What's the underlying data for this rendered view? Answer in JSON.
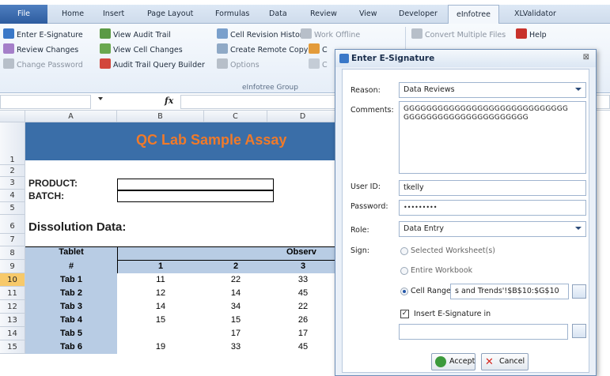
{
  "ribbon": {
    "tabs": [
      "File",
      "Home",
      "Insert",
      "Page Layout",
      "Formulas",
      "Data",
      "Review",
      "View",
      "Developer",
      "eInfotree",
      "XLValidator"
    ],
    "group_label": "eInfotree Group",
    "buttons": {
      "enter_esig": "Enter E-Signature",
      "review_changes": "Review Changes",
      "change_password": "Change Password",
      "view_audit_trail": "View Audit Trail",
      "view_cell_changes": "View Cell Changes",
      "audit_query_builder": "Audit Trail Query Builder",
      "cell_revision_history": "Cell Revision History",
      "create_remote_copy": "Create Remote Copy",
      "options": "Options",
      "work_offline": "Work Offline",
      "convert_multiple": "Convert Multiple Files",
      "help": "Help",
      "extra_c1": "C",
      "extra_c2": "C"
    }
  },
  "formula_bar": {
    "fx": "fx"
  },
  "sheet": {
    "columns": [
      "A",
      "B",
      "C",
      "D"
    ],
    "rows": [
      "1",
      "2",
      "3",
      "4",
      "5",
      "6",
      "7",
      "8",
      "9",
      "10",
      "11",
      "12",
      "13",
      "14",
      "15"
    ],
    "banner_title": "QC Lab Sample Assay",
    "product_label": "PRODUCT:",
    "batch_label": "BATCH:",
    "dissolution_label": "Dissolution Data:",
    "tablet_header": "Tablet",
    "hash_header": "#",
    "observ_header": "Observ",
    "obs_cols": [
      "1",
      "2",
      "3"
    ],
    "data_rows": [
      {
        "tab": "Tab 1",
        "v": [
          "11",
          "22",
          "33"
        ]
      },
      {
        "tab": "Tab 2",
        "v": [
          "12",
          "14",
          "45"
        ]
      },
      {
        "tab": "Tab 3",
        "v": [
          "14",
          "34",
          "22"
        ]
      },
      {
        "tab": "Tab 4",
        "v": [
          "15",
          "15",
          "26"
        ]
      },
      {
        "tab": "Tab 5",
        "v": [
          "",
          "17",
          "17"
        ]
      },
      {
        "tab": "Tab 6",
        "v": [
          "19",
          "33",
          "45"
        ]
      }
    ]
  },
  "dialog": {
    "title": "Enter E-Signature",
    "reason_label": "Reason:",
    "reason_value": "Data Reviews",
    "comments_label": "Comments:",
    "comments_line1": "GGGGGGGGGGGGGGGGGGGGGGGGGGGGG",
    "comments_line2": "GGGGGGGGGGGGGGGGGGGGGG",
    "userid_label": "User ID:",
    "userid_value": "tkelly",
    "password_label": "Password:",
    "password_value": "•••••••••",
    "role_label": "Role:",
    "role_value": "Data Entry",
    "sign_label": "Sign:",
    "opt_selected_ws": "Selected Worksheet(s)",
    "opt_entire_wb": "Entire Workbook",
    "opt_cell_range": "Cell Range",
    "cell_range_value": "s and Trends'!$B$10:$G$10",
    "insert_esig_label": "Insert E-Signature in",
    "accept_label": "Accept",
    "cancel_label": "Cancel"
  }
}
